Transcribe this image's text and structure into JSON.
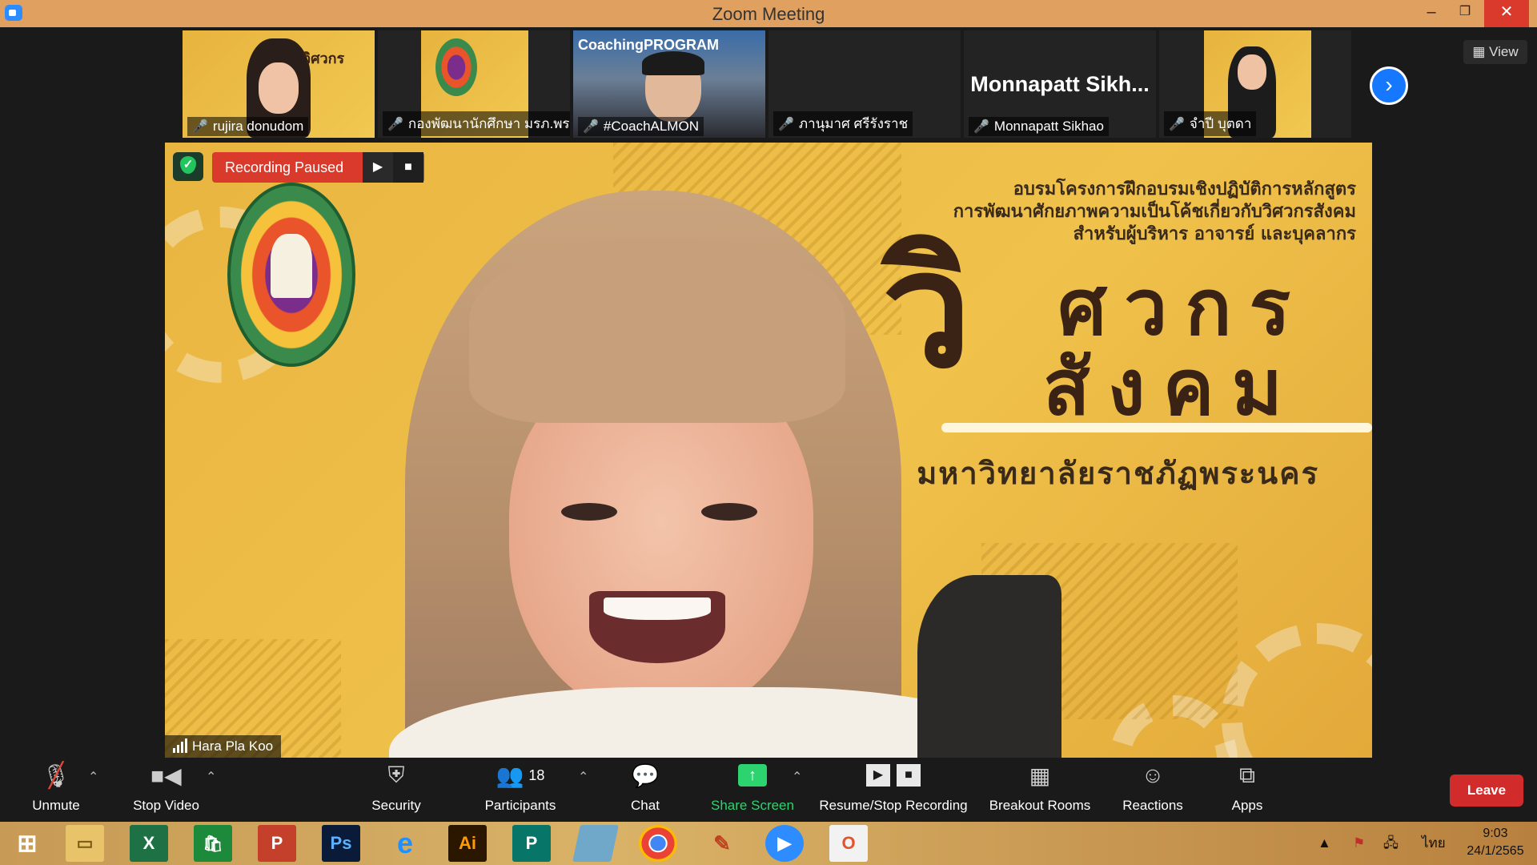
{
  "window": {
    "title": "Zoom Meeting"
  },
  "participants_strip": {
    "tiles": [
      {
        "name": "rujira donudom",
        "muted": true
      },
      {
        "name": "กองพัฒนานักศึกษา มรภ.พร...",
        "muted": true
      },
      {
        "name": "#CoachALMON",
        "muted": true
      },
      {
        "name": "ภานุมาศ ศรีรังราช",
        "muted": true
      },
      {
        "name": "Monnapatt Sikhao",
        "display": "Monnapatt Sikh...",
        "muted": true
      },
      {
        "name": "จำปี บุตดา",
        "muted": true
      }
    ],
    "view_label": "View",
    "coach_banner": "CoachingPROGRAM"
  },
  "recording": {
    "status": "Recording Paused"
  },
  "main_video": {
    "speaker_name": "Hara Pla Koo",
    "slide": {
      "line1": "อบรมโครงการฝึกอบรมเชิงปฏิบัติการหลักสูตร",
      "line2": "การพัฒนาศักยภาพความเป็นโค้ชเกี่ยวกับวิศวกรสังคม",
      "line3": "สำหรับผู้บริหาร อาจารย์ และบุคลากร",
      "headline_big": "วิ",
      "headline_1": "ศวกร",
      "headline_2": "สังคม",
      "university": "มหาวิทยาลัยราชภัฏพระนคร"
    }
  },
  "toolbar": {
    "unmute": "Unmute",
    "stop_video": "Stop Video",
    "security": "Security",
    "participants": "Participants",
    "participants_count": "18",
    "chat": "Chat",
    "share_screen": "Share Screen",
    "recording": "Resume/Stop Recording",
    "breakout": "Breakout Rooms",
    "reactions": "Reactions",
    "apps": "Apps",
    "leave": "Leave"
  },
  "taskbar": {
    "apps": [
      "Windows",
      "File Explorer",
      "Excel",
      "Store",
      "PowerPoint",
      "Photoshop",
      "Internet Explorer",
      "Illustrator",
      "Publisher",
      "Notepad",
      "Chrome",
      "Paint",
      "Zoom",
      "Office"
    ],
    "icon_letters": {
      "excel": "X",
      "photoshop": "Ps",
      "illustrator": "Ai",
      "publisher": "P"
    },
    "language": "ไทย",
    "time": "9:03",
    "date": "24/1/2565"
  },
  "colors": {
    "accent": "#2d8cff",
    "record": "#d93a2b",
    "share": "#2dd36f",
    "slide_bg": "#f0c24b"
  }
}
